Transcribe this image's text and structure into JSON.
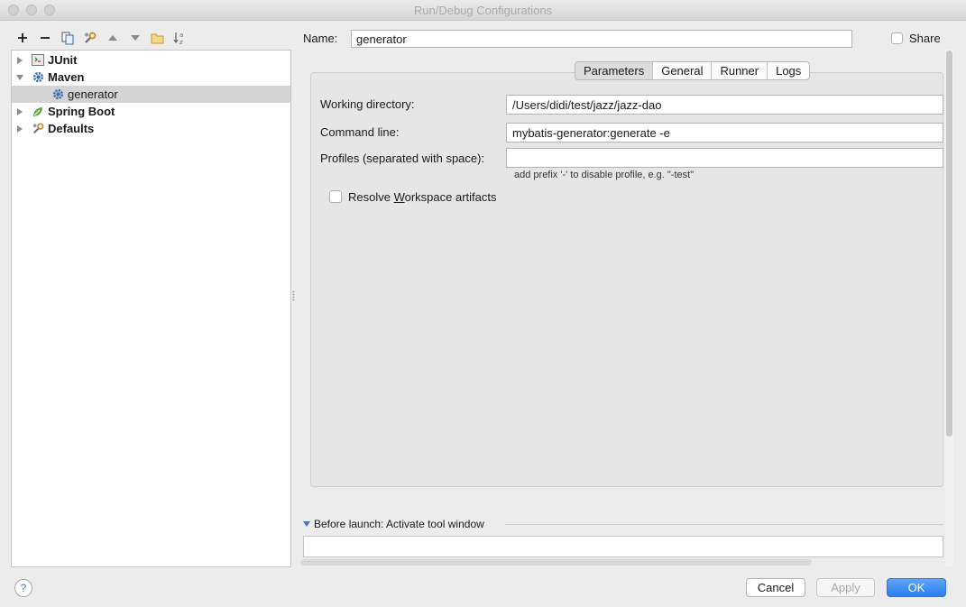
{
  "window": {
    "title": "Run/Debug Configurations"
  },
  "toolbar": {
    "icons": [
      "plus-icon",
      "minus-icon",
      "copy-icon",
      "wrench-icon",
      "arrow-up-icon",
      "arrow-down-icon",
      "folder-icon",
      "sort-az-icon"
    ]
  },
  "tree": {
    "items": [
      {
        "label": "JUnit",
        "icon": "junit-icon",
        "expanded": false
      },
      {
        "label": "Maven",
        "icon": "maven-gear-icon",
        "expanded": true
      },
      {
        "label": "generator",
        "icon": "gear-icon",
        "selected": true
      },
      {
        "label": "Spring Boot",
        "icon": "spring-leaf-icon",
        "expanded": false
      },
      {
        "label": "Defaults",
        "icon": "wrench-icon",
        "expanded": false
      }
    ]
  },
  "config": {
    "name_label": "Name:",
    "name_value": "generator",
    "share_label": "Share",
    "share_checked": false
  },
  "tabs": [
    {
      "label": "Parameters",
      "active": true
    },
    {
      "label": "General",
      "active": false
    },
    {
      "label": "Runner",
      "active": false
    },
    {
      "label": "Logs",
      "active": false
    }
  ],
  "parameters": {
    "working_directory_label": "Working directory:",
    "working_directory_value": "/Users/didi/test/jazz/jazz-dao",
    "command_line_label": "Command line:",
    "command_line_value": "mybatis-generator:generate -e",
    "profiles_label": "Profiles (separated with space):",
    "profiles_value": "",
    "profiles_hint": "add prefix '-' to disable profile, e.g. \"-test\"",
    "resolve_label_pre": "Resolve ",
    "resolve_label_mnemonic": "W",
    "resolve_label_post": "orkspace artifacts",
    "resolve_checked": false
  },
  "before_launch": {
    "label": "Before launch: Activate tool window"
  },
  "buttons": {
    "help": "?",
    "cancel": "Cancel",
    "apply": "Apply",
    "ok": "OK"
  },
  "colors": {
    "accent": "#2a7ef0",
    "selection": "#d4d4d4"
  }
}
